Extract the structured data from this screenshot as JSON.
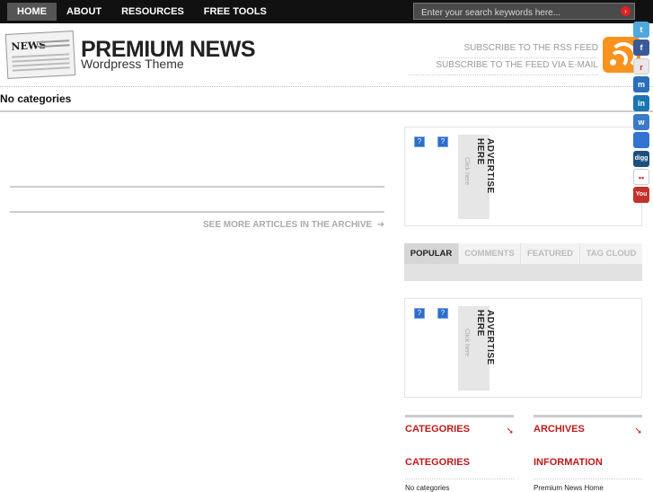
{
  "nav": {
    "items": [
      {
        "label": "HOME",
        "active": true
      },
      {
        "label": "ABOUT",
        "active": false
      },
      {
        "label": "RESOURCES",
        "active": false
      },
      {
        "label": "FREE TOOLS",
        "active": false
      }
    ]
  },
  "search": {
    "placeholder": "Enter your search keywords here..."
  },
  "header": {
    "logo_word": "NEWS",
    "title": "PREMIUM NEWS",
    "subtitle": "Wordpress Theme",
    "subscribe_rss": "SUBSCRIBE TO THE RSS FEED",
    "subscribe_email": "SUBSCRIBE TO THE FEED VIA E-MAIL"
  },
  "category_label": "No categories",
  "main": {
    "archive_link": "SEE MORE ARTICLES IN THE ARCHIVE"
  },
  "ads": {
    "vertical_title": "ADVERTISE HERE",
    "vertical_sub": "Click here",
    "placeholder_glyph": "?"
  },
  "tabs": [
    {
      "label": "POPULAR",
      "active": true
    },
    {
      "label": "COMMENTS",
      "active": false
    },
    {
      "label": "FEATURED",
      "active": false
    },
    {
      "label": "TAG CLOUD",
      "active": false
    }
  ],
  "widgets": {
    "left_header": "CATEGORIES",
    "right_header": "ARCHIVES",
    "left_title": "CATEGORIES",
    "right_title": "INFORMATION",
    "left_item": "No categories",
    "right_item": "Premium News Home"
  },
  "social_icons": [
    {
      "name": "twitter-icon",
      "glyph": "t",
      "color": "#4fa8dc"
    },
    {
      "name": "facebook-icon",
      "glyph": "f",
      "color": "#3b5998"
    },
    {
      "name": "reddit-icon",
      "glyph": "r",
      "color": "#e8e8e8"
    },
    {
      "name": "myspace-icon",
      "glyph": "m",
      "color": "#2a6fb8"
    },
    {
      "name": "linkedin-icon",
      "glyph": "in",
      "color": "#1a75b2"
    },
    {
      "name": "windows-live-icon",
      "glyph": "w",
      "color": "#3a7bc8"
    },
    {
      "name": "delicious-icon",
      "glyph": "",
      "color": "#3274d0"
    },
    {
      "name": "digg-icon",
      "glyph": "digg",
      "color": "#1c4f80"
    },
    {
      "name": "flickr-icon",
      "glyph": "••",
      "color": "#ffffff"
    },
    {
      "name": "youtube-icon",
      "glyph": "You",
      "color": "#c4302b"
    }
  ],
  "colors": {
    "accent": "#c0191a",
    "topbar": "#111111",
    "rss": "#f7931e"
  }
}
